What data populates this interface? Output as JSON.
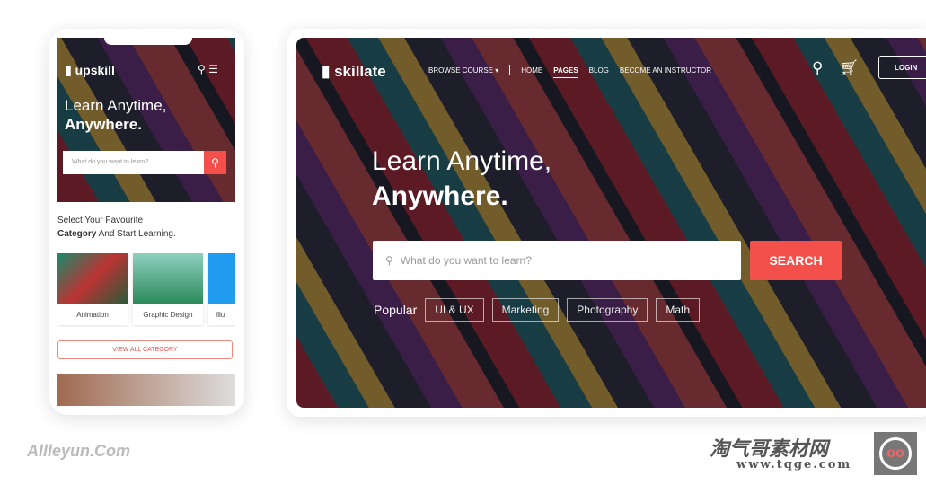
{
  "mobile": {
    "brand": "upskill",
    "title_line1": "Learn Anytime,",
    "title_line2": "Anywhere.",
    "search_placeholder": "What do you want to learn?",
    "select_line1": "Select Your Favourite",
    "select_bold": "Category",
    "select_rest": " And Start Learning.",
    "categories": [
      {
        "label": "Animation"
      },
      {
        "label": "Graphic Design"
      },
      {
        "label": "Illu"
      }
    ],
    "view_all": "VIEW ALL CATEGORY"
  },
  "desktop": {
    "brand": "skillate",
    "nav": {
      "browse": "BROWSE COURSE ▾",
      "home": "HOME",
      "pages": "PAGES",
      "blog": "BLOG",
      "instructor": "BECOME AN INSTRUCTOR"
    },
    "login": "LOGIN",
    "title_line1": "Learn Anytime,",
    "title_line2": "Anywhere.",
    "search_placeholder": "What do you want to learn?",
    "search_button": "SEARCH",
    "popular_label": "Popular",
    "tags": [
      "UI & UX",
      "Marketing",
      "Photography",
      "Math"
    ]
  },
  "watermarks": {
    "left": "Allleyun.Com",
    "right_cn": "淘气哥素材网",
    "right_url": "www.tqge.com"
  },
  "colors": {
    "accent": "#f4504b"
  }
}
